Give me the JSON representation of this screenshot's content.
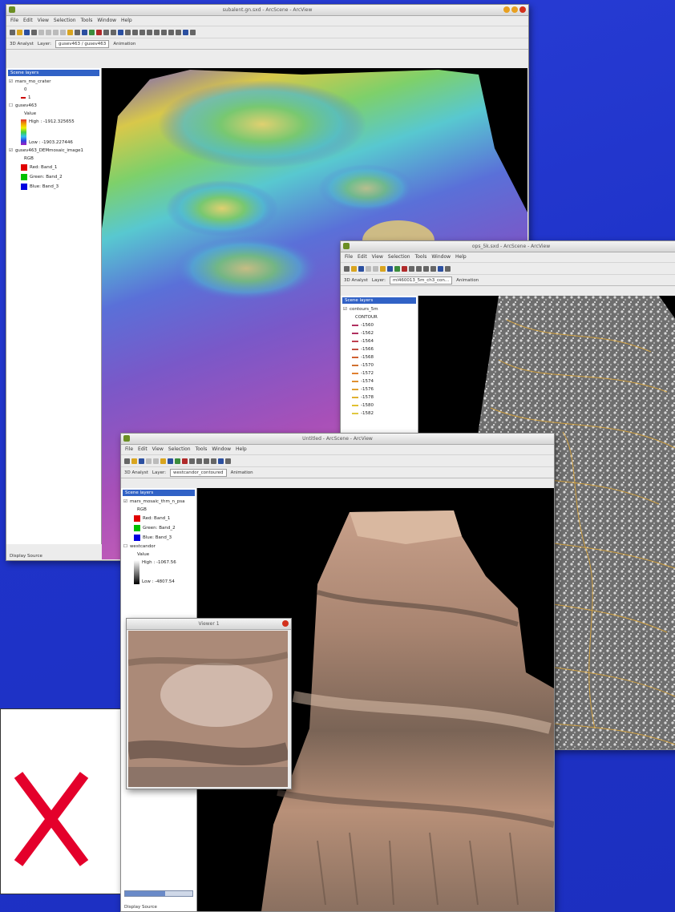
{
  "window1": {
    "title": "subalent.gn.sxd - ArcScene - ArcView",
    "menu": [
      "File",
      "Edit",
      "View",
      "Selection",
      "Tools",
      "Window",
      "Help"
    ],
    "analyst_label": "3D Analyst",
    "layer_label": "Layer:",
    "layer_value": "gusev463 / gusev463",
    "animation_label": "Animation",
    "toc_header": "Scene layers",
    "layers": [
      {
        "name": "mars_mo_crater",
        "items": [
          "0",
          "1"
        ]
      },
      {
        "name": "gusev463",
        "items": [
          "Value",
          "High : -1912.325655",
          "Low : -1903.227446"
        ]
      },
      {
        "name": "gusev463_DEMmosaic_image1",
        "items": [
          "RGB",
          "Red: Band_1",
          "Green: Band_2",
          "Blue: Band_3"
        ]
      }
    ],
    "status_tabs": "Display  Source"
  },
  "window2": {
    "title": "ops_5k.sxd - ArcScene - ArcView",
    "menu": [
      "File",
      "Edit",
      "View",
      "Selection",
      "Tools",
      "Window",
      "Help"
    ],
    "analyst_label": "3D Analyst",
    "layer_label": "Layer:",
    "layer_value": "ml460013_5m_ch3_con...",
    "animation_label": "Animation",
    "toc_header": "Scene layers",
    "layer_name": "contours_5m",
    "layer_field": "CONTOUR",
    "contour_values": [
      "-1560",
      "-1562",
      "-1564",
      "-1566",
      "-1568",
      "-1570",
      "-1572",
      "-1574",
      "-1576",
      "-1578",
      "-1580",
      "-1582"
    ]
  },
  "window3": {
    "title": "Untitled - ArcScene - ArcView",
    "menu": [
      "File",
      "Edit",
      "View",
      "Selection",
      "Tools",
      "Window",
      "Help"
    ],
    "analyst_label": "3D Analyst",
    "layer_label": "Layer:",
    "layer_value": "westcandor_contoured",
    "animation_label": "Animation",
    "toc_header": "Scene layers",
    "layers": [
      {
        "name": "mars_mosaic_thm_n_psa",
        "items": [
          "RGB",
          "Red: Band_1",
          "Green: Band_2",
          "Blue: Band_3"
        ]
      },
      {
        "name": "westcandor",
        "items": [
          "Value",
          "High : -1067.56",
          "Low : -4807.54"
        ]
      }
    ],
    "status_tabs": "Display  Source",
    "viewer_title": "Viewer 1"
  },
  "colors": {
    "background": "#2437cf",
    "x_mark": "#e4002b"
  }
}
